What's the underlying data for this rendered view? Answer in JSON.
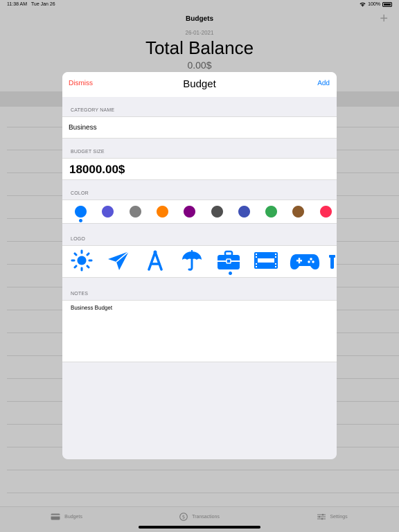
{
  "status": {
    "time": "11:38 AM",
    "date": "Tue Jan 26",
    "battery": "100%"
  },
  "nav": {
    "title": "Budgets",
    "add_glyph": "+"
  },
  "header": {
    "date": "26-01-2021",
    "title": "Total Balance",
    "balance": "0.00$"
  },
  "tabs": [
    {
      "label": "Budgets",
      "icon": "card-icon"
    },
    {
      "label": "Transactions",
      "icon": "dollar-circle-icon"
    },
    {
      "label": "Settings",
      "icon": "sliders-icon"
    }
  ],
  "sheet": {
    "dismiss": "Dismiss",
    "title": "Budget",
    "add": "Add",
    "category_header": "CATEGORY NAME",
    "category_value": "Business",
    "size_header": "BUDGET SIZE",
    "size_value": "18000.00$",
    "color_header": "COLOR",
    "colors": [
      "#007aff",
      "#5856d6",
      "#808080",
      "#ff8000",
      "#800080",
      "#505050",
      "#3f51b5",
      "#34a853",
      "#8b5a2b",
      "#ff2d55"
    ],
    "selected_color": 0,
    "logo_header": "LOGO",
    "logos": [
      "sun-icon",
      "paperplane-icon",
      "compass-icon",
      "umbrella-icon",
      "briefcase-icon",
      "film-icon",
      "gamecontroller-icon",
      "partial-icon"
    ],
    "selected_logo": 4,
    "notes_header": "NOTES",
    "notes_value": "Business Budget",
    "accent": "#007aff",
    "destructive": "#ff3b30"
  }
}
